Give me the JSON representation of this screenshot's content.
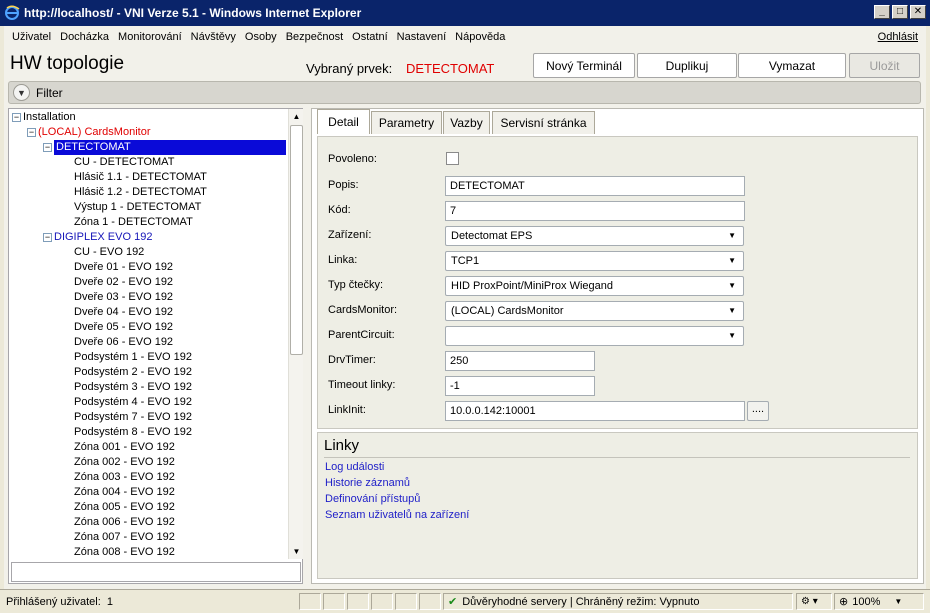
{
  "window": {
    "title": "http://localhost/ - VNI Verze 5.1 - Windows Internet Explorer",
    "min": "_",
    "max": "□",
    "close": "✕"
  },
  "menu": {
    "items": [
      "Uživatel",
      "Docházka",
      "Monitorování",
      "Návštěvy",
      "Osoby",
      "Bezpečnost",
      "Ostatní",
      "Nastavení",
      "Nápověda"
    ],
    "logout": "Odhlásit"
  },
  "header": {
    "title": "HW topologie",
    "selected_label": "Vybraný prvek:",
    "selected_value": "DETECTOMAT"
  },
  "toolbar": {
    "new_terminal": "Nový Terminál",
    "duplicate": "Duplikuj",
    "delete": "Vymazat",
    "save": "Uložit"
  },
  "filter": {
    "label": "Filter"
  },
  "tree": {
    "items": [
      {
        "label": "Installation",
        "toggle": "−"
      },
      {
        "label": "(LOCAL) CardsMonitor",
        "toggle": "−"
      },
      {
        "label": "DETECTOMAT",
        "toggle": "−"
      },
      {
        "label": "CU - DETECTOMAT"
      },
      {
        "label": "Hlásič 1.1 - DETECTOMAT"
      },
      {
        "label": "Hlásič 1.2 - DETECTOMAT"
      },
      {
        "label": "Výstup 1 - DETECTOMAT"
      },
      {
        "label": "Zóna 1 - DETECTOMAT"
      },
      {
        "label": "DIGIPLEX EVO 192",
        "toggle": "−"
      },
      {
        "label": "CU - EVO 192"
      },
      {
        "label": "Dveře 01 - EVO 192"
      },
      {
        "label": "Dveře 02 - EVO 192"
      },
      {
        "label": "Dveře 03 - EVO 192"
      },
      {
        "label": "Dveře 04 - EVO 192"
      },
      {
        "label": "Dveře 05 - EVO 192"
      },
      {
        "label": "Dveře 06 - EVO 192"
      },
      {
        "label": "Podsystém 1 - EVO 192"
      },
      {
        "label": "Podsystém 2 - EVO 192"
      },
      {
        "label": "Podsystém 3 - EVO 192"
      },
      {
        "label": "Podsystém 4 - EVO 192"
      },
      {
        "label": "Podsystém 7 - EVO 192"
      },
      {
        "label": "Podsystém 8 - EVO 192"
      },
      {
        "label": "Zóna 001 - EVO 192"
      },
      {
        "label": "Zóna 002 - EVO 192"
      },
      {
        "label": "Zóna 003 - EVO 192"
      },
      {
        "label": "Zóna 004 - EVO 192"
      },
      {
        "label": "Zóna 005 - EVO 192"
      },
      {
        "label": "Zóna 006 - EVO 192"
      },
      {
        "label": "Zóna 007 - EVO 192"
      },
      {
        "label": "Zóna 008 - EVO 192"
      }
    ],
    "scroll_up": "▲",
    "scroll_down": "▼"
  },
  "tabs": [
    "Detail",
    "Parametry",
    "Vazby",
    "Servisní stránka"
  ],
  "detail": {
    "enabled_label": "Povoleno:",
    "description_label": "Popis:",
    "description_value": "DETECTOMAT",
    "code_label": "Kód:",
    "code_value": "7",
    "device_label": "Zařízení:",
    "device_value": "Detectomat EPS",
    "line_label": "Linka:",
    "line_value": "TCP1",
    "reader_label": "Typ čtečky:",
    "reader_value": "HID ProxPoint/MiniProx Wiegand",
    "cardsmonitor_label": "CardsMonitor:",
    "cardsmonitor_value": "(LOCAL) CardsMonitor",
    "parent_label": "ParentCircuit:",
    "parent_value": "",
    "drvtimer_label": "DrvTimer:",
    "drvtimer_value": "250",
    "timeout_label": "Timeout linky:",
    "timeout_value": "-1",
    "linkinit_label": "LinkInit:",
    "linkinit_value": "10.0.0.142:10001",
    "dots": "....",
    "caret": "▼"
  },
  "links": {
    "title": "Linky",
    "items": [
      "Log události",
      "Historie záznamů",
      "Definování přístupů",
      "Seznam uživatelů na zařízení"
    ]
  },
  "status": {
    "user_label": "Přihlášený uživatel:",
    "user_value": "1",
    "trust": "Důvěryhodné servery | Chráněný režim: Vypnuto",
    "zoom": "100%"
  },
  "colors": {
    "titlebar": "#0a246a",
    "selected_red": "#e00000",
    "tree_blue": "#1515b8",
    "link_blue": "#1e1ec8",
    "selection": "#0a0ad8"
  }
}
